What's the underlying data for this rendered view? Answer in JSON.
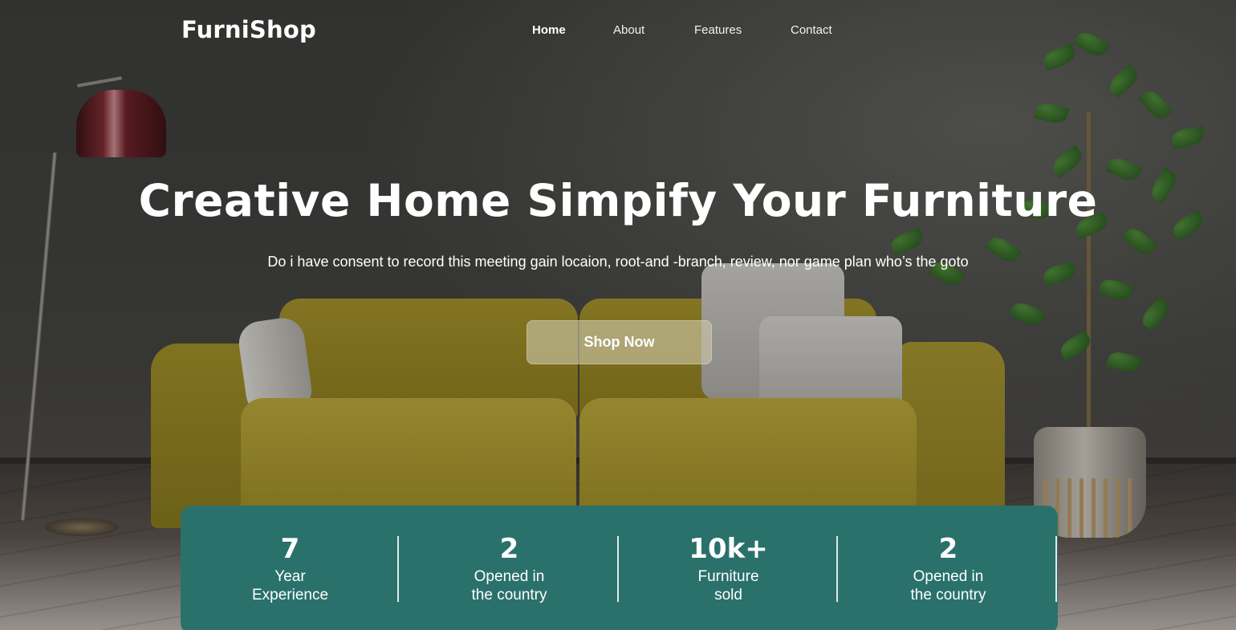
{
  "brand": {
    "name": "FurniShop"
  },
  "nav": {
    "items": [
      {
        "label": "Home",
        "active": true
      },
      {
        "label": "About",
        "active": false
      },
      {
        "label": "Features",
        "active": false
      },
      {
        "label": "Contact",
        "active": false
      }
    ]
  },
  "hero": {
    "title": "Creative Home Simpify Your Furniture",
    "subtitle": "Do i have consent to record this meeting gain locaion, root-and -branch, review, nor game plan who’s the goto",
    "cta_label": "Shop Now"
  },
  "stats": [
    {
      "value": "7",
      "label_line1": "Year",
      "label_line2": "Experience"
    },
    {
      "value": "2",
      "label_line1": "Opened in",
      "label_line2": "the country"
    },
    {
      "value": "10k+",
      "label_line1": "Furniture",
      "label_line2": "sold"
    },
    {
      "value": "2",
      "label_line1": "Opened in",
      "label_line2": "the country"
    }
  ],
  "colors": {
    "stats_panel": "#2a716b",
    "cta_background": "#cdc6aa",
    "text": "#ffffff"
  }
}
